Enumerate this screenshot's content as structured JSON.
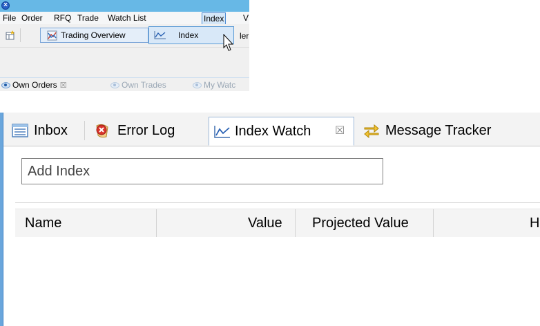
{
  "window": {
    "menu": [
      "File",
      "Order",
      "RFQ",
      "Trade",
      "Watch List",
      "Index",
      "V"
    ],
    "selected_menu": "Index"
  },
  "toolbar": {
    "trading_overview_label": "Trading Overview",
    "index_label": "Index",
    "cutoff_text": "ler"
  },
  "view_tabs": [
    {
      "label": "Own Orders",
      "closable": true
    },
    {
      "label": "Own Trades"
    },
    {
      "label": "My Watc"
    }
  ],
  "panel": {
    "tabs": [
      {
        "label": "Inbox",
        "icon": "inbox-icon"
      },
      {
        "label": "Error Log",
        "icon": "error-log-icon"
      },
      {
        "label": "Index Watch",
        "icon": "line-chart-icon",
        "active": true,
        "close": "☒"
      },
      {
        "label": "Message Tracker",
        "icon": "message-tracker-icon"
      }
    ],
    "add_index_placeholder": "Add Index",
    "columns": [
      "Name",
      "Value",
      "Projected Value",
      "H"
    ]
  },
  "colors": {
    "titlebar": "#67b8e6",
    "selection_border": "#4a8bd4",
    "panel_accent": "#6aa6dc"
  }
}
